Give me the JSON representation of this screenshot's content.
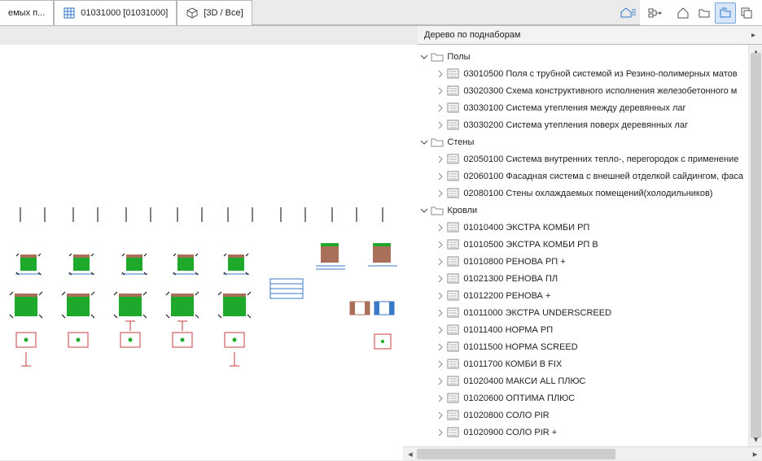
{
  "tabs": [
    {
      "label": "емых п...",
      "icon": "blank"
    },
    {
      "label": "01031000 [01031000]",
      "icon": "grid"
    },
    {
      "label": "[3D / Все]",
      "icon": "cube"
    }
  ],
  "tab_strip_icon": "house-split",
  "top_toolbar": {
    "left": [
      {
        "name": "structure-mode-button",
        "icon": "structure-mode"
      }
    ],
    "right": [
      {
        "name": "view-house-button",
        "icon": "house-outline",
        "active": false
      },
      {
        "name": "view-folder-button",
        "icon": "folder-outline",
        "active": false
      },
      {
        "name": "view-layers-button",
        "icon": "layers-outline",
        "active": true
      },
      {
        "name": "view-stack-button",
        "icon": "stack-outline",
        "active": false
      }
    ]
  },
  "panel_title": "Дерево по поднаборам",
  "tree": [
    {
      "label": "Полы",
      "type": "folder",
      "expanded": true,
      "children": [
        {
          "label": "03010500 Поля с трубной системой из Резино-полимерных матов",
          "type": "item"
        },
        {
          "label": "03020300 Схема конструктивного исполнения железобетонного м",
          "type": "item"
        },
        {
          "label": "03030100 Система утепления между деревянных лаг",
          "type": "item"
        },
        {
          "label": "03030200 Система утепления поверх деревянных лаг",
          "type": "item"
        }
      ]
    },
    {
      "label": "Стены",
      "type": "folder",
      "expanded": true,
      "children": [
        {
          "label": "02050100 Система внутренних тепло-, перегородок с применение",
          "type": "item"
        },
        {
          "label": "02060100 Фасадная система с внешней отделкой сайдингом, фаса",
          "type": "item"
        },
        {
          "label": "02080100 Стены охлаждаемых помещений(холодильников)",
          "type": "item"
        }
      ]
    },
    {
      "label": "Кровли",
      "type": "folder",
      "expanded": true,
      "children": [
        {
          "label": "01010400 ЭКСТРА КОМБИ РП",
          "type": "item"
        },
        {
          "label": "01010500 ЭКСТРА КОМБИ РП В",
          "type": "item"
        },
        {
          "label": "01010800 РЕНОВА РП +",
          "type": "item"
        },
        {
          "label": "01021300 РЕНОВА ПЛ",
          "type": "item"
        },
        {
          "label": "01012200 РЕНОВА +",
          "type": "item"
        },
        {
          "label": "01011000 ЭКСТРА UNDERSCREED",
          "type": "item"
        },
        {
          "label": "01011400 НОРМА РП",
          "type": "item"
        },
        {
          "label": "01011500 НОРМА SCREED",
          "type": "item"
        },
        {
          "label": "01011700 КОМБИ В FIX",
          "type": "item"
        },
        {
          "label": "01020400 МАКСИ ALL ПЛЮС",
          "type": "item"
        },
        {
          "label": "01020600 ОПТИМА ПЛЮС",
          "type": "item"
        },
        {
          "label": "01020800 СОЛО PIR",
          "type": "item"
        },
        {
          "label": "01020900 СОЛО PIR +",
          "type": "item"
        }
      ]
    }
  ],
  "colors": {
    "green": "#1ea82c",
    "brown": "#a97059",
    "red": "#c83c3c",
    "blue": "#3a78c8",
    "pale": "#f5d8d0"
  }
}
